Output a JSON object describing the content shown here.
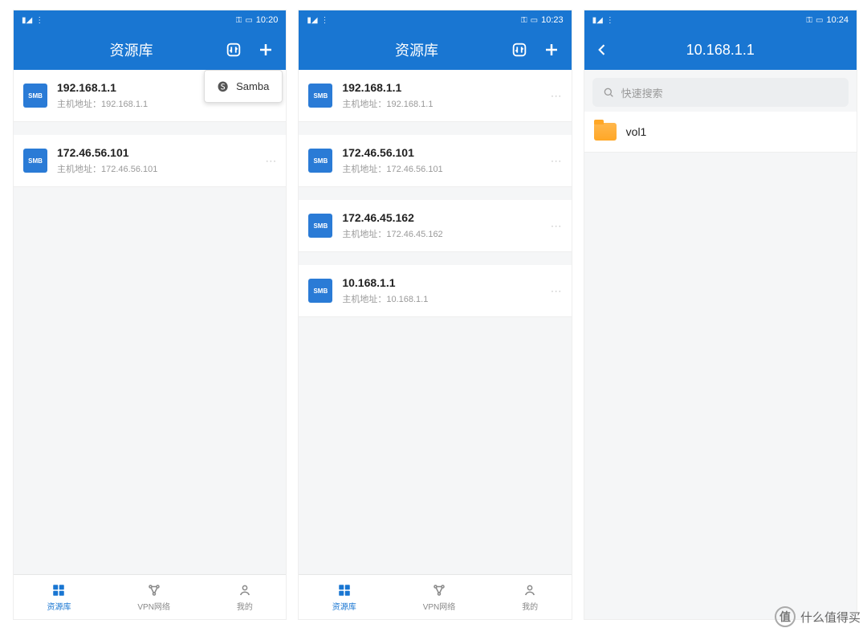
{
  "colors": {
    "primary": "#1976d2",
    "folder": "#ffa726"
  },
  "watermark": {
    "badge": "值",
    "text": "什么值得买"
  },
  "screens": [
    {
      "statusbar": {
        "left_text": "",
        "time": "10:20",
        "battery": ""
      },
      "appbar": {
        "title": "资源库",
        "has_back": false,
        "has_transfer": true,
        "has_add": true
      },
      "dropdown": {
        "visible": true,
        "label": "Samba",
        "icon_name": "samba-icon"
      },
      "servers": [
        {
          "name": "192.168.1.1",
          "sub_label": "主机地址：",
          "sub_value": "192.168.1.1"
        },
        {
          "name": "172.46.56.101",
          "sub_label": "主机地址：",
          "sub_value": "172.46.56.101"
        }
      ],
      "bottomnav": [
        {
          "label": "资源库",
          "active": true,
          "icon": "grid"
        },
        {
          "label": "VPN网络",
          "active": false,
          "icon": "vpn"
        },
        {
          "label": "我的",
          "active": false,
          "icon": "user"
        }
      ]
    },
    {
      "statusbar": {
        "left_text": "",
        "time": "10:23",
        "battery": ""
      },
      "appbar": {
        "title": "资源库",
        "has_back": false,
        "has_transfer": true,
        "has_add": true
      },
      "dropdown": {
        "visible": false
      },
      "servers": [
        {
          "name": "192.168.1.1",
          "sub_label": "主机地址：",
          "sub_value": "192.168.1.1"
        },
        {
          "name": "172.46.56.101",
          "sub_label": "主机地址：",
          "sub_value": "172.46.56.101"
        },
        {
          "name": "172.46.45.162",
          "sub_label": "主机地址：",
          "sub_value": "172.46.45.162"
        },
        {
          "name": "10.168.1.1",
          "sub_label": "主机地址：",
          "sub_value": "10.168.1.1"
        }
      ],
      "bottomnav": [
        {
          "label": "资源库",
          "active": true,
          "icon": "grid"
        },
        {
          "label": "VPN网络",
          "active": false,
          "icon": "vpn"
        },
        {
          "label": "我的",
          "active": false,
          "icon": "user"
        }
      ]
    },
    {
      "statusbar": {
        "left_text": "",
        "time": "10:24",
        "battery": ""
      },
      "appbar": {
        "title": "10.168.1.1",
        "has_back": true,
        "has_transfer": false,
        "has_add": false
      },
      "search": {
        "placeholder": "快速搜索"
      },
      "folders": [
        {
          "name": "vol1"
        }
      ]
    }
  ]
}
